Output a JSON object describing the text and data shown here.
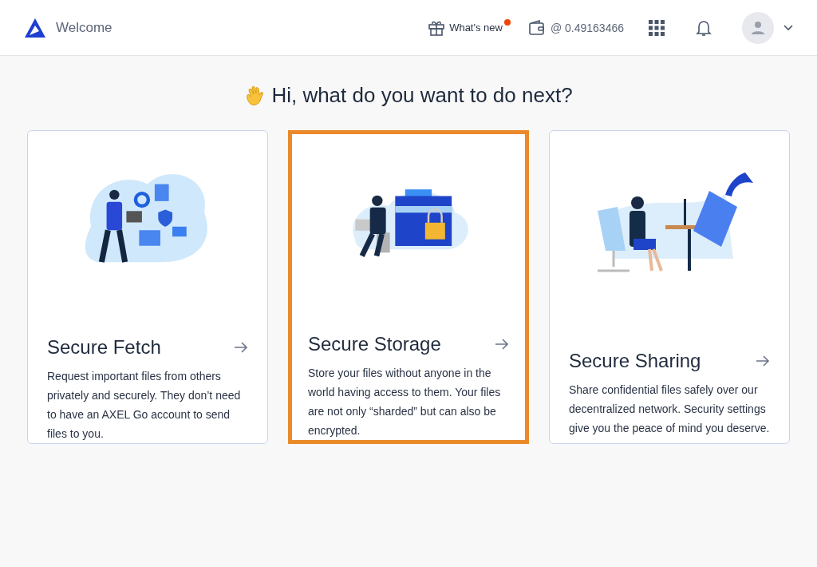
{
  "header": {
    "title": "Welcome",
    "whats_new": {
      "label": "What's new",
      "unread": true
    },
    "balance": "@ 0.49163466"
  },
  "heading": "Hi, what do you want to do next?",
  "cards": [
    {
      "kind": "fetch",
      "title": "Secure Fetch",
      "text": "Request important files from others privately and securely. They don’t need to have an AXEL Go account to send files to you.",
      "selected": false
    },
    {
      "kind": "storage",
      "title": "Secure Storage",
      "text": "Store your files without anyone in the world having access to them. Your files are not only “sharded” but can also be encrypted.",
      "selected": true
    },
    {
      "kind": "sharing",
      "title": "Secure Sharing",
      "text": "Share confidential files safely over our decentralized network. Security settings give you the peace of mind you deserve.",
      "selected": false
    }
  ]
}
